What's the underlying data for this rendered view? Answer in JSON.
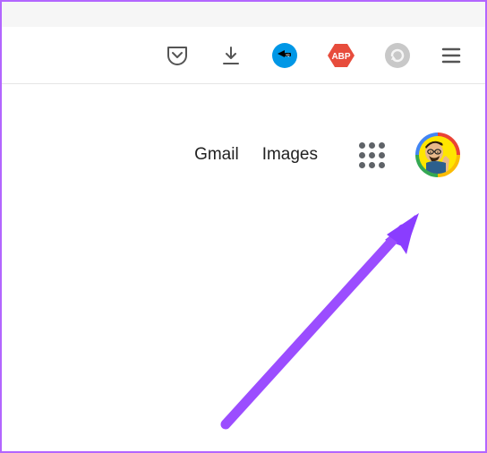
{
  "toolbar": {
    "icons": {
      "pocket": "pocket-icon",
      "download": "download-icon",
      "ext_iq": "IQ",
      "ext_abp": "ABP",
      "refresh": "refresh-icon",
      "menu": "menu-icon"
    }
  },
  "nav": {
    "gmail": "Gmail",
    "images": "Images",
    "apps": "apps-grid-icon",
    "account": "account-avatar"
  },
  "annotation": {
    "arrow_color": "#9b4dff",
    "arrow_target": "account-avatar"
  }
}
